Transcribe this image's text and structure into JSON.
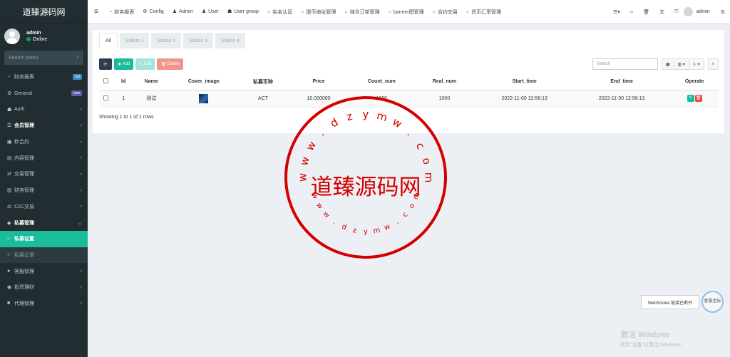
{
  "sidebar": {
    "logo": "道臻源码网",
    "user": {
      "name": "admin",
      "status": "Online"
    },
    "search_placeholder": "Search menu",
    "items": [
      {
        "label": "财务报表",
        "icon": "dashboard-icon",
        "badge": "hot",
        "badge_color": "#3c8dbc"
      },
      {
        "label": "General",
        "icon": "cogs-icon",
        "badge": "new",
        "badge_color": "#605ca8"
      },
      {
        "label": "Auth",
        "icon": "group-icon",
        "arrow": "‹"
      },
      {
        "label": "会员管理",
        "icon": "list-icon",
        "arrow": "‹",
        "bold": true
      },
      {
        "label": "秒合约",
        "icon": "calendar-icon",
        "arrow": "‹"
      },
      {
        "label": "内容管理",
        "icon": "book-icon",
        "arrow": "‹"
      },
      {
        "label": "交易管理",
        "icon": "exchange-icon",
        "arrow": "‹"
      },
      {
        "label": "财务管理",
        "icon": "file-icon",
        "arrow": "‹"
      },
      {
        "label": "C2C交易",
        "icon": "scale-icon",
        "arrow": "‹"
      },
      {
        "label": "私募管理",
        "icon": "diamond-icon",
        "arrow": "⌄",
        "bold": true
      },
      {
        "label": "私募设置",
        "icon": "circle-icon",
        "active": true
      },
      {
        "label": "私募记录",
        "icon": "circle-icon",
        "sub": true
      },
      {
        "label": "客服管理",
        "icon": "comment-icon",
        "arrow": "‹"
      },
      {
        "label": "投资理财",
        "icon": "dollar-icon",
        "arrow": "‹"
      },
      {
        "label": "代理管理",
        "icon": "briefcase-icon",
        "arrow": "‹"
      }
    ]
  },
  "topnav": {
    "items": [
      {
        "label": "财务报表",
        "icon": "dashboard-icon"
      },
      {
        "label": "Config",
        "icon": "cog-icon"
      },
      {
        "label": "Admin",
        "icon": "user-icon"
      },
      {
        "label": "User",
        "icon": "user-icon"
      },
      {
        "label": "User group",
        "icon": "users-icon"
      },
      {
        "label": "实名认证",
        "icon": "circle-icon"
      },
      {
        "label": "提币地址管理",
        "icon": "circle-icon"
      },
      {
        "label": "持仓订单管理",
        "icon": "circle-icon"
      },
      {
        "label": "banner图管理",
        "icon": "circle-icon"
      },
      {
        "label": "合约交易",
        "icon": "circle-icon"
      },
      {
        "label": "货币汇率管理",
        "icon": "circle-icon"
      }
    ],
    "user": "admin"
  },
  "tabs": [
    "All",
    "Status 1",
    "Status 2",
    "Status 3",
    "Status 4"
  ],
  "toolbar": {
    "add": "Add",
    "edit": "Edit",
    "delete": "Delete",
    "search_placeholder": "Search"
  },
  "table": {
    "columns": [
      "Id",
      "Name",
      "Cover_image",
      "私募币种",
      "Price",
      "Count_num",
      "Real_num",
      "Start_time",
      "End_time",
      "Operate"
    ],
    "rows": [
      {
        "id": "1",
        "name": "测试",
        "coin": "ACT",
        "price": "10.000000",
        "count": "1000",
        "real": "1000",
        "start": "2022-11-09 12:56:13",
        "end": "2022-11-30 12:56:13"
      }
    ],
    "footer": "Showing 1 to 1 of 1 rows"
  },
  "stamp": {
    "center": "道臻源码网",
    "ring": "www.dzymw.com",
    "color": "#d40000"
  },
  "websocket": {
    "tip": "WebSocket 链接已断开",
    "bubble": "客服坐标"
  },
  "windows": {
    "line1": "激活 Windows",
    "line2": "转到\"设置\"以激活 Windows。"
  }
}
